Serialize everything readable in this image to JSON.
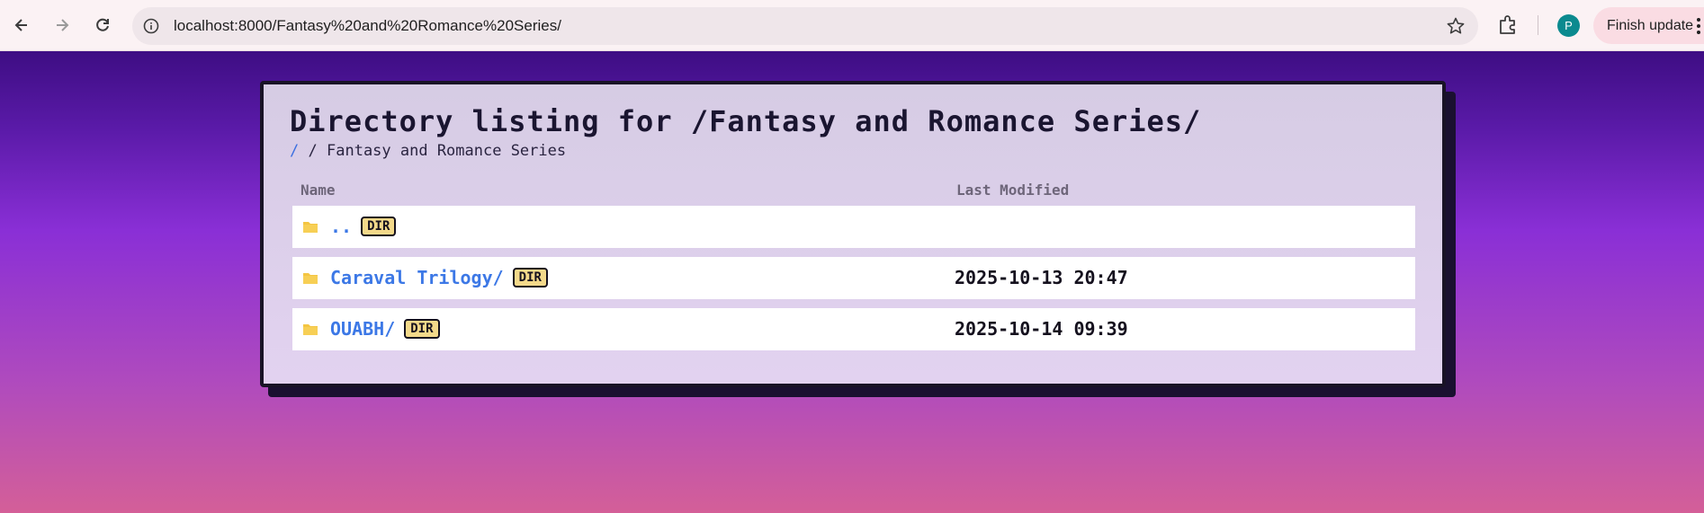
{
  "browser": {
    "url": "localhost:8000/Fantasy%20and%20Romance%20Series/",
    "profile_initial": "P",
    "finish_update_label": "Finish update",
    "icons": [
      "back-icon",
      "forward-icon",
      "reload-icon",
      "site-info-icon",
      "bookmark-star-icon",
      "extensions-icon",
      "menu-dots-icon"
    ]
  },
  "page": {
    "title": "Directory listing for /Fantasy and Romance Series/",
    "breadcrumb": {
      "root": "/",
      "separator": "/",
      "current": "Fantasy and Romance Series"
    },
    "columns": {
      "name": "Name",
      "modified": "Last Modified"
    },
    "entries": [
      {
        "name": "..",
        "badge": "DIR",
        "modified": ""
      },
      {
        "name": "Caraval Trilogy/",
        "badge": "DIR",
        "modified": "2025-10-13 20:47"
      },
      {
        "name": "OUABH/",
        "badge": "DIR",
        "modified": "2025-10-14 09:39"
      }
    ]
  },
  "colors": {
    "link": "#3c78e6",
    "badge_bg": "#f3d98a",
    "folder": "#f4c542",
    "card_border": "#191326"
  }
}
